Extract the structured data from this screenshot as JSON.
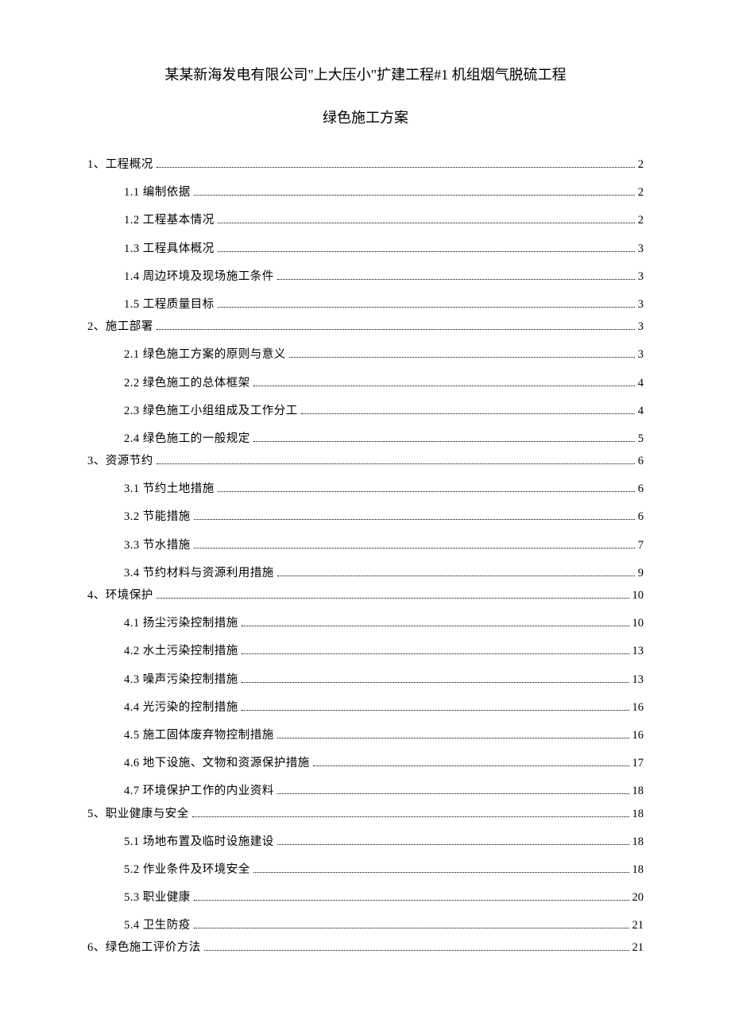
{
  "title_line1": "某某新海发电有限公司\"上大压小\"扩建工程#1 机组烟气脱硫工程",
  "title_line2": "绿色施工方案",
  "toc": [
    {
      "level": 1,
      "label": "1、工程概况",
      "page": "2"
    },
    {
      "level": 2,
      "label": "1.1 编制依据",
      "page": "2"
    },
    {
      "level": 2,
      "label": "1.2 工程基本情况",
      "page": "2"
    },
    {
      "level": 2,
      "label": "1.3 工程具体概况",
      "page": "3"
    },
    {
      "level": 2,
      "label": "1.4 周边环境及现场施工条件",
      "page": "3"
    },
    {
      "level": 2,
      "label": "1.5 工程质量目标",
      "page": "3"
    },
    {
      "level": 1,
      "label": "2、施工部署",
      "page": "3"
    },
    {
      "level": 2,
      "label": "2.1 绿色施工方案的原则与意义",
      "page": "3"
    },
    {
      "level": 2,
      "label": "2.2 绿色施工的总体框架",
      "page": "4"
    },
    {
      "level": 2,
      "label": "2.3 绿色施工小组组成及工作分工",
      "page": "4"
    },
    {
      "level": 2,
      "label": "2.4 绿色施工的一般规定",
      "page": "5"
    },
    {
      "level": 1,
      "label": "3、资源节约",
      "page": "6"
    },
    {
      "level": 2,
      "label": "3.1 节约土地措施",
      "page": "6"
    },
    {
      "level": 2,
      "label": "3.2 节能措施",
      "page": "6"
    },
    {
      "level": 2,
      "label": "3.3 节水措施",
      "page": "7"
    },
    {
      "level": 2,
      "label": "3.4 节约材料与资源利用措施",
      "page": "9"
    },
    {
      "level": 1,
      "label": "4、环境保护",
      "page": "10"
    },
    {
      "level": 2,
      "label": "4.1 扬尘污染控制措施",
      "page": "10"
    },
    {
      "level": 2,
      "label": "4.2 水土污染控制措施",
      "page": "13"
    },
    {
      "level": 2,
      "label": "4.3 噪声污染控制措施",
      "page": "13"
    },
    {
      "level": 2,
      "label": "4.4 光污染的控制措施",
      "page": "16"
    },
    {
      "level": 2,
      "label": "4.5 施工固体废弃物控制措施",
      "page": "16"
    },
    {
      "level": 2,
      "label": "4.6 地下设施、文物和资源保护措施",
      "page": "17"
    },
    {
      "level": 2,
      "label": "4.7 环境保护工作的内业资料",
      "page": "18"
    },
    {
      "level": 1,
      "label": "5、职业健康与安全",
      "page": "18"
    },
    {
      "level": 2,
      "label": "5.1 场地布置及临时设施建设",
      "page": "18"
    },
    {
      "level": 2,
      "label": "5.2 作业条件及环境安全",
      "page": "18"
    },
    {
      "level": 2,
      "label": "5.3 职业健康",
      "page": "20"
    },
    {
      "level": 2,
      "label": "5.4 卫生防疫",
      "page": "21"
    },
    {
      "level": 1,
      "label": "6、绿色施工评价方法",
      "page": "21"
    }
  ]
}
